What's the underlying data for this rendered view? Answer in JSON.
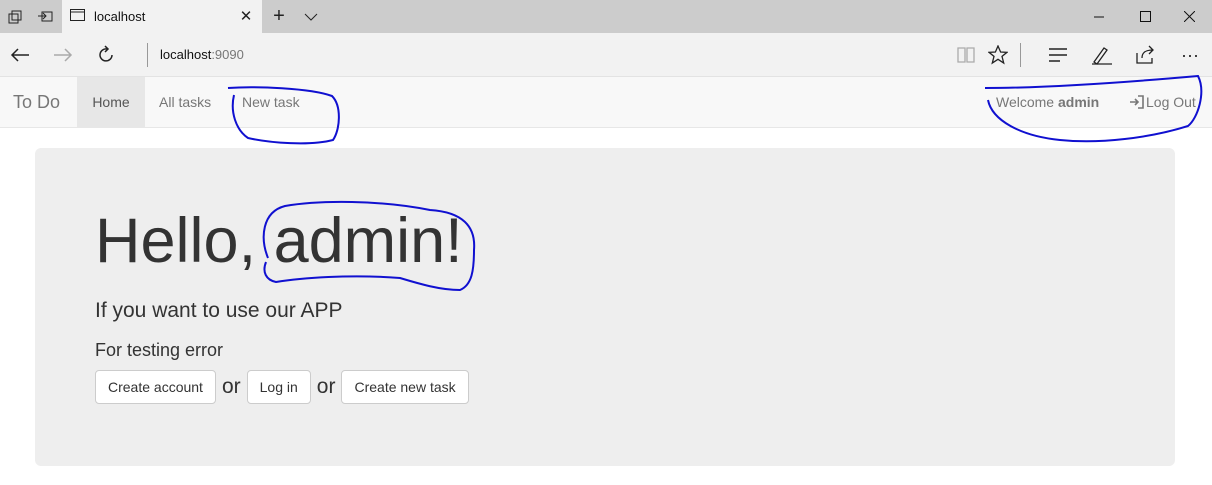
{
  "browser": {
    "tab_title": "localhost",
    "address_host": "localhost",
    "address_port": ":9090"
  },
  "app": {
    "brand": "To Do",
    "nav": {
      "home": "Home",
      "all_tasks": "All tasks",
      "new_task": "New task"
    },
    "welcome_prefix": "Welcome",
    "welcome_user": "admin",
    "logout": "Log Out"
  },
  "jumbotron": {
    "greeting": "Hello, admin!",
    "lead": "If you want to use our APP",
    "testing": "For testing error",
    "buttons": {
      "create_account": "Create account",
      "log_in": "Log in",
      "create_task": "Create new task"
    },
    "or_1": "or",
    "or_2": "or"
  },
  "colors": {
    "annotation": "#1010d0",
    "nav_bg": "#f8f8f8",
    "jumbotron_bg": "#eeeeee"
  }
}
